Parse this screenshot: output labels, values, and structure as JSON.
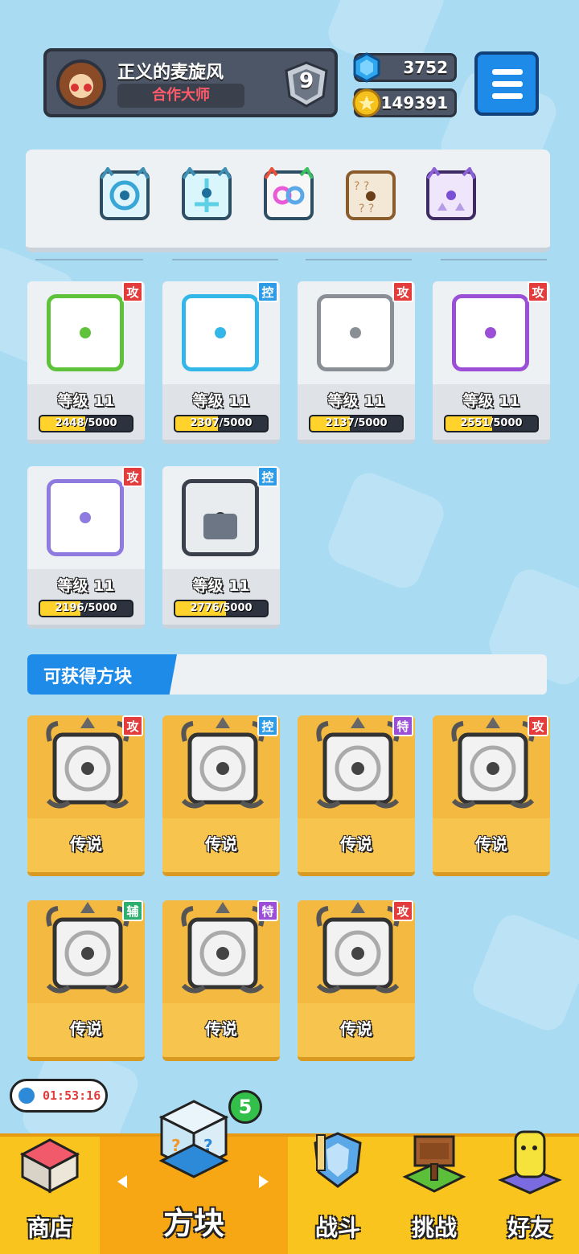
{
  "player": {
    "name": "正义的麦旋风",
    "title": "合作大师",
    "rank": "9"
  },
  "currency": {
    "gems": "3752",
    "coins": "149391"
  },
  "deck": {
    "slots": [
      "blue-vortex-die",
      "cyan-crystal-die",
      "rainbow-infinity-die",
      "mystery-question-die",
      "purple-arrow-die"
    ]
  },
  "owned_dice": [
    {
      "type_tag": "攻",
      "level": "等级 11",
      "progress_text": "2448/5000",
      "progress": 0.4896,
      "color": "#5ec23a"
    },
    {
      "type_tag": "控",
      "level": "等级 11",
      "progress_text": "2307/5000",
      "progress": 0.4614,
      "color": "#33b6e8"
    },
    {
      "type_tag": "攻",
      "level": "等级 11",
      "progress_text": "2137/5000",
      "progress": 0.4274,
      "color": "#8a8f96"
    },
    {
      "type_tag": "攻",
      "level": "等级 11",
      "progress_text": "2551/5000",
      "progress": 0.5102,
      "color": "#9a4fd6"
    },
    {
      "type_tag": "攻",
      "level": "等级 11",
      "progress_text": "2196/5000",
      "progress": 0.4392,
      "color": "#8f7be0"
    },
    {
      "type_tag": "控",
      "level": "等级 11",
      "progress_text": "2776/5000",
      "progress": 0.5552,
      "color": "#3a414d"
    }
  ],
  "available": {
    "header": "可获得方块",
    "cards": [
      {
        "type_tag": "攻",
        "rarity": "传说",
        "icon": "vortex-legend-die-icon"
      },
      {
        "type_tag": "控",
        "rarity": "传说",
        "icon": "splash-legend-die-icon"
      },
      {
        "type_tag": "特",
        "rarity": "传说",
        "icon": "pentagram-legend-die-icon"
      },
      {
        "type_tag": "攻",
        "rarity": "传说",
        "icon": "atom-legend-die-icon"
      },
      {
        "type_tag": "辅",
        "rarity": "传说",
        "icon": "moon-legend-die-icon"
      },
      {
        "type_tag": "特",
        "rarity": "传说",
        "icon": "demon-legend-die-icon"
      },
      {
        "type_tag": "攻",
        "rarity": "传说",
        "icon": "blackhole-legend-die-icon"
      }
    ]
  },
  "timer": "01:53:16",
  "nav": {
    "shop": "商店",
    "dice": "方块",
    "battle": "战斗",
    "challenge": "挑战",
    "friends": "好友",
    "dice_badge": "5"
  },
  "colors": {
    "attack": "#e23c3c",
    "control": "#2d9be6",
    "special": "#9a4fd6",
    "support": "#2eae6e",
    "nav_bg": "#f9c41e",
    "accent_blue": "#1f8be8"
  }
}
